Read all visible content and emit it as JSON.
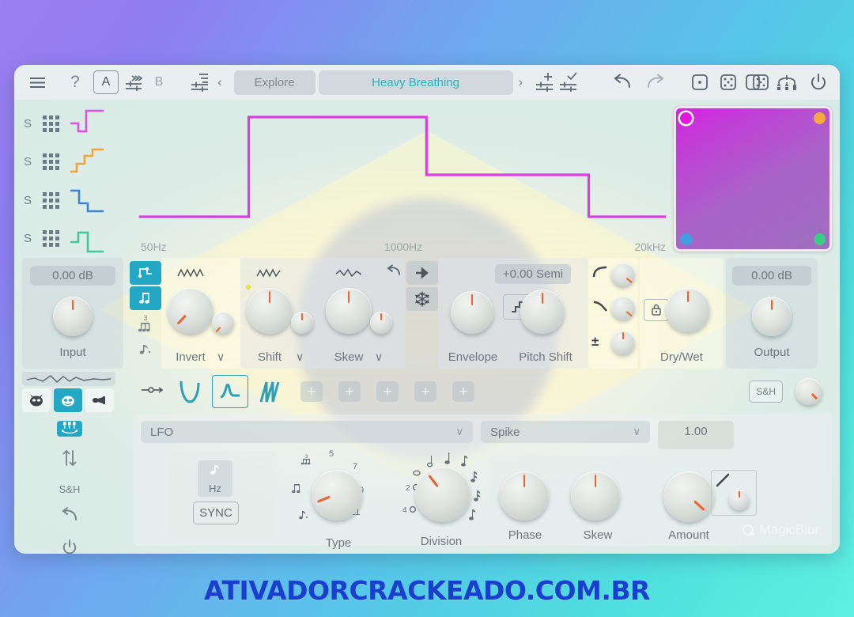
{
  "toolbar": {
    "menu_icon": "hamburger-icon",
    "help_label": "?",
    "ab_a": "A",
    "ab_b": "B",
    "explore_label": "Explore",
    "preset_name": "Heavy Breathing",
    "prev_label": "‹",
    "next_label": "›",
    "accent": "#23b4bd"
  },
  "spectrum": {
    "lanes": [
      {
        "solo": "S",
        "color": "#e04fe0"
      },
      {
        "solo": "S",
        "color": "#f0a53c"
      },
      {
        "solo": "S",
        "color": "#3f82d6"
      },
      {
        "solo": "S",
        "color": "#3fc99a"
      }
    ],
    "freq_labels": [
      "50Hz",
      "1000Hz",
      "20kHz"
    ],
    "curve_color": "#d93fe0"
  },
  "xypad": {
    "corners": [
      {
        "name": "magenta",
        "color": "#e017dd",
        "selected": true
      },
      {
        "name": "orange",
        "color": "#f5a93f",
        "selected": false
      },
      {
        "name": "blue",
        "color": "#3f9fe0",
        "selected": false
      },
      {
        "name": "green",
        "color": "#3fca86",
        "selected": false
      }
    ]
  },
  "input_section": {
    "value": "0.00 dB",
    "label": "Input"
  },
  "note_buttons": [
    {
      "name": "step-icon",
      "active": true
    },
    {
      "name": "note-icon",
      "active": true
    },
    {
      "name": "triplet-icon",
      "active": false,
      "sup": "3"
    },
    {
      "name": "dotted-note-icon",
      "active": false
    }
  ],
  "shape_knobs": [
    {
      "label": "Invert",
      "value_deg": -137
    },
    {
      "label": "Shift",
      "value_deg": 0
    },
    {
      "label": "Skew",
      "value_deg": 0
    }
  ],
  "reset_icon": "undo-icon",
  "arrow_btn": "arrow-right-icon",
  "freeze_btn": "snowflake-icon",
  "envelope": {
    "label": "Envelope",
    "value_deg": 0
  },
  "pitch": {
    "value": "+0.00 Semi",
    "label": "Pitch Shift",
    "stair_icon": "staircase-icon",
    "value_deg": 0
  },
  "side_knobs": [
    {
      "name": "attack-curve-icon",
      "value_deg": 128
    },
    {
      "name": "release-curve-icon",
      "value_deg": 130
    },
    {
      "name": "plus-minus-icon",
      "value_deg": 0
    }
  ],
  "drywet": {
    "label": "Dry/Wet",
    "lock_icon": "lock-icon",
    "value_deg": 0
  },
  "output_section": {
    "value": "0.00 dB",
    "label": "Output"
  },
  "mode_icons": [
    {
      "name": "ninja-icon",
      "active": false
    },
    {
      "name": "devil-icon",
      "active": true
    },
    {
      "name": "trumpet-icon",
      "active": false
    }
  ],
  "wave_tabs": [
    {
      "name": "sine-wave-icon",
      "selected": false
    },
    {
      "name": "spike-wave-icon",
      "selected": true
    },
    {
      "name": "saw-wave-icon",
      "selected": false
    }
  ],
  "plus_buttons": [
    "+",
    "+",
    "+",
    "+",
    "+"
  ],
  "sh_button": {
    "label": "S&H",
    "knob_deg": 135
  },
  "lfo_left_icons": [
    {
      "name": "lfo-grid-icon",
      "active": true
    },
    {
      "name": "updown-arrow-icon",
      "active": false
    },
    {
      "name": "sample-hold-label",
      "label": "S&H",
      "active": false
    },
    {
      "name": "undo-icon",
      "active": false
    },
    {
      "name": "power-icon",
      "active": false
    }
  ],
  "lfo_panel": {
    "source_select": "LFO",
    "rate_mode": {
      "hz_label": "Hz",
      "hz_icon": "note-icon",
      "sync_label": "SYNC"
    },
    "type_knob": {
      "label": "Type",
      "value_deg": -112,
      "marks": [
        "5",
        "7",
        "9",
        "11"
      ]
    },
    "division_knob": {
      "label": "Division",
      "value_deg": -38
    },
    "shape_select": "Spike",
    "phase_knob": {
      "label": "Phase",
      "value_deg": 0
    },
    "skew_knob": {
      "label": "Skew",
      "value_deg": 0
    },
    "amount_value": "1.00",
    "amount_knob": {
      "label": "Amount",
      "value_deg": 133
    },
    "amount_mod_icon": "slope-icon"
  },
  "brand": {
    "name": "MagicBlur",
    "logo_icon": "magic-logo-icon"
  },
  "watermark": {
    "text": "ATIVADORCRACKEADO.COM.BR",
    "color": "#1a3fd0"
  }
}
